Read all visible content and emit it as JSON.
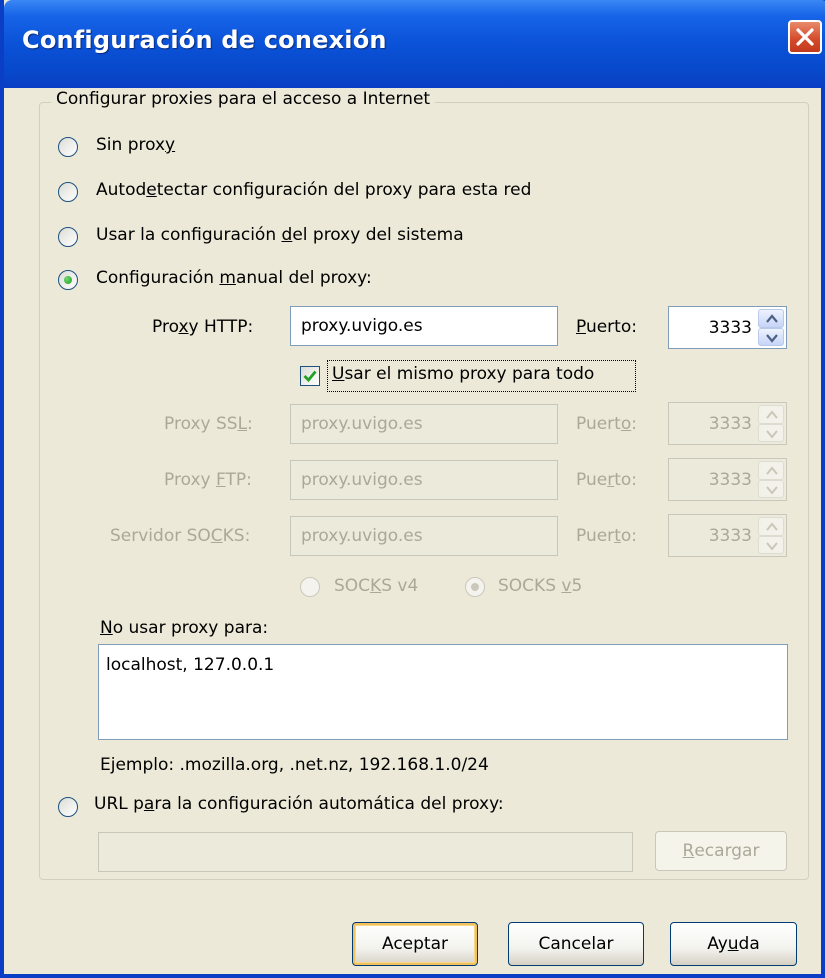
{
  "window": {
    "title": "Configuración de conexión"
  },
  "group": {
    "legend": "Configurar proxies para el acceso a Internet"
  },
  "options": {
    "no_proxy": {
      "pre": "Sin prox",
      "key": "y",
      "post": ""
    },
    "autodetect": {
      "pre": "Autod",
      "key": "e",
      "post": "tectar configuración del proxy para esta red"
    },
    "system": {
      "pre": "Usar la configuración ",
      "key": "d",
      "post": "el proxy del sistema"
    },
    "manual": {
      "pre": "Configuración ",
      "key": "m",
      "post": "anual del proxy:",
      "selected": true
    }
  },
  "manual": {
    "http": {
      "label_pre": "Pro",
      "label_key": "x",
      "label_post": "y HTTP:",
      "value": "proxy.uvigo.es",
      "port_label_key": "P",
      "port_label_post": "uerto:",
      "port": "3333"
    },
    "same_for_all": {
      "key": "U",
      "post": "sar el mismo proxy para todo",
      "checked": true
    },
    "ssl": {
      "label_pre": "Proxy SS",
      "label_key": "L",
      "label_post": ":",
      "value": "proxy.uvigo.es",
      "port_label_pre": "Puert",
      "port_label_key": "o",
      "port_label_post": ":",
      "port": "3333"
    },
    "ftp": {
      "label_pre": "Proxy ",
      "label_key": "F",
      "label_post": "TP:",
      "value": "proxy.uvigo.es",
      "port_label_pre": "Pue",
      "port_label_key": "r",
      "port_label_post": "to:",
      "port": "3333"
    },
    "socks": {
      "label_pre": "Servidor SO",
      "label_key": "C",
      "label_post": "KS:",
      "value": "proxy.uvigo.es",
      "port_label_pre": "Puer",
      "port_label_key": "t",
      "port_label_post": "o:",
      "port": "3333"
    },
    "socks_v4": {
      "pre": "SOC",
      "key": "K",
      "post": "S v4"
    },
    "socks_v5": {
      "pre": "SOCKS ",
      "key": "v",
      "post": "5",
      "selected": true
    }
  },
  "no_proxy": {
    "label_key": "N",
    "label_post": "o usar proxy para:",
    "value": "localhost, 127.0.0.1",
    "example": "Ejemplo: .mozilla.org, .net.nz, 192.168.1.0/24"
  },
  "autoconfig": {
    "pre": "URL p",
    "key": "a",
    "post": "ra la configuración automática del proxy:",
    "url_value": "",
    "reload_key": "R",
    "reload_post": "ecargar"
  },
  "buttons": {
    "ok": "Aceptar",
    "cancel": "Cancelar",
    "help_pre": "Ay",
    "help_key": "u",
    "help_post": "da"
  },
  "colors": {
    "title_bar": "#0a52d8",
    "dialog_bg": "#ece9d8",
    "disabled_text": "#aca899",
    "close_button": "#d4492a"
  }
}
